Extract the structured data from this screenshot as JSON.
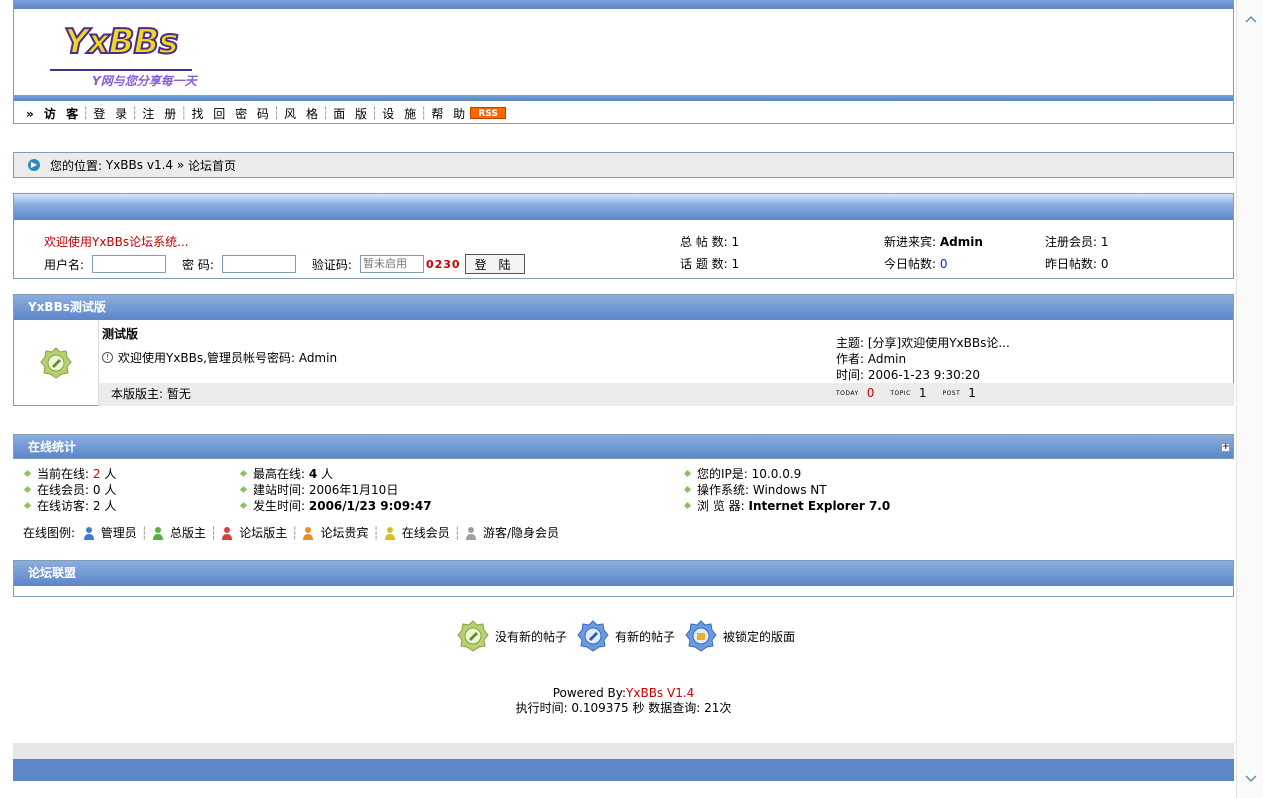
{
  "logo": {
    "main": "YxBBs",
    "tagline": "Y网与您分享每一天"
  },
  "nav": {
    "items": [
      "» 访 客",
      "登 录",
      "注 册",
      "找 回 密 码",
      "风 格",
      "面 版",
      "设 施",
      "帮 助"
    ],
    "rss": "RSS"
  },
  "breadcrumb": {
    "prefix": "您的位置:",
    "home": "YxBBs v1.4",
    "arrow": "»",
    "current": "论坛首页"
  },
  "welcome": {
    "message": "欢迎使用YxBBs论坛系统...",
    "username_label": "用户名:",
    "password_label": "密 码:",
    "captcha_label": "验证码:",
    "captcha_placeholder": "暂未启用",
    "captcha_code": "0230",
    "login_button": "登 陆"
  },
  "stats": {
    "total_posts_label": "总 帖 数:",
    "total_posts": "1",
    "topics_label": "话 题 数:",
    "topics": "1",
    "newest_label": "新进来宾:",
    "newest": "Admin",
    "today_label": "今日帖数:",
    "today": "0",
    "members_label": "注册会员:",
    "members": "1",
    "yesterday_label": "昨日帖数:",
    "yesterday": "0"
  },
  "forum_section": {
    "title": "YxBBs测试版",
    "forum_name": "测试版",
    "description": "欢迎使用YxBBs,管理员帐号密码: Admin",
    "moderator": "本版版主: 暂无",
    "last_topic": "主题: [分享]欢迎使用YxBBs论...",
    "last_author": "作者: Admin",
    "last_time": "时间: 2006-1-23 9:30:20",
    "today_label": "TODAY",
    "today": "0",
    "topic_label": "TOPIC",
    "topic": "1",
    "post_label": "POST",
    "post": "1"
  },
  "online": {
    "title": "在线统计",
    "current_label": "当前在线:",
    "current": "2",
    "current_unit": "人",
    "members_label": "在线会员:",
    "members": "0 人",
    "guests_label": "在线访客:",
    "guests": "2 人",
    "max_label": "最高在线:",
    "max": "4",
    "max_unit": "人",
    "built_label": "建站时间:",
    "built": "2006年1月10日",
    "occur_label": "发生时间:",
    "occur": "2006/1/23 9:09:47",
    "ip_label": "您的IP是:",
    "ip": "10.0.0.9",
    "os_label": "操作系统:",
    "os": "Windows NT",
    "browser_label": "浏 览 器:",
    "browser": "Internet Explorer 7.0",
    "legend_label": "在线图例:",
    "legend": [
      "管理员",
      "总版主",
      "论坛版主",
      "论坛贵宾",
      "在线会员",
      "游客/隐身会员"
    ]
  },
  "alliance": {
    "title": "论坛联盟"
  },
  "icon_legend": [
    "没有新的帖子",
    "有新的帖子",
    "被锁定的版面"
  ],
  "footer": {
    "powered_prefix": "Powered By:",
    "powered_brand": "YxBBs V1.4",
    "exec": "执行时间: 0.109375 秒 数据查询: 21次"
  },
  "colors": {
    "header_blue": "#5b86c8",
    "accent_red": "#cc0000",
    "border": "#7f9db9"
  }
}
